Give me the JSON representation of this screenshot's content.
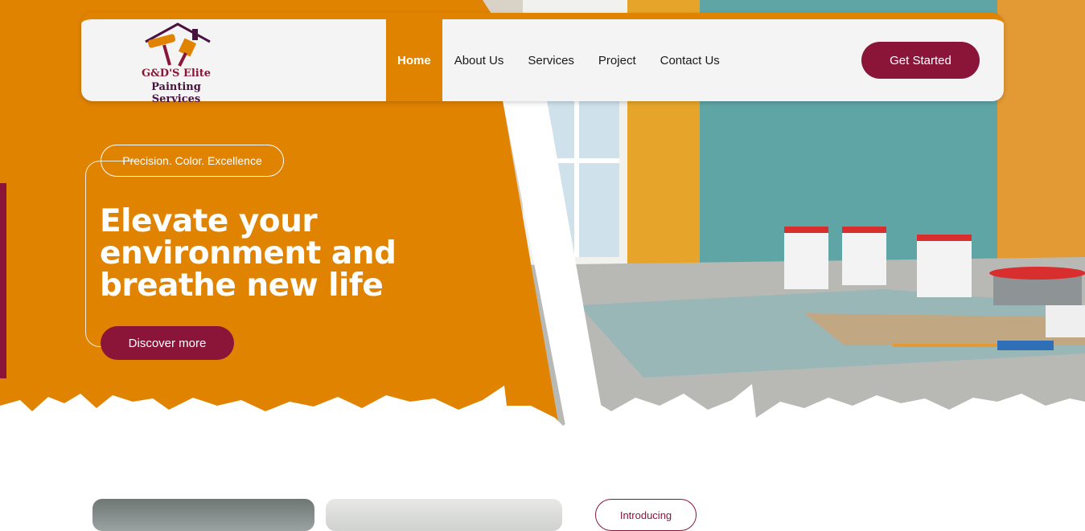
{
  "brand": {
    "name_line1": "G&D'S Elite",
    "name_line2": "Painting Services"
  },
  "nav": {
    "items": [
      {
        "label": "Home",
        "active": true
      },
      {
        "label": "About Us",
        "active": false
      },
      {
        "label": "Services",
        "active": false
      },
      {
        "label": "Project",
        "active": false
      },
      {
        "label": "Contact Us",
        "active": false
      }
    ],
    "cta_label": "Get Started"
  },
  "hero": {
    "tagline": "Precision. Color. Excellence",
    "headline": "Elevate your environment and breathe new life",
    "button_label": "Discover more"
  },
  "section": {
    "intro_label": "Introducing"
  },
  "colors": {
    "orange": "#e08300",
    "maroon": "#8a1538",
    "white": "#ffffff"
  }
}
